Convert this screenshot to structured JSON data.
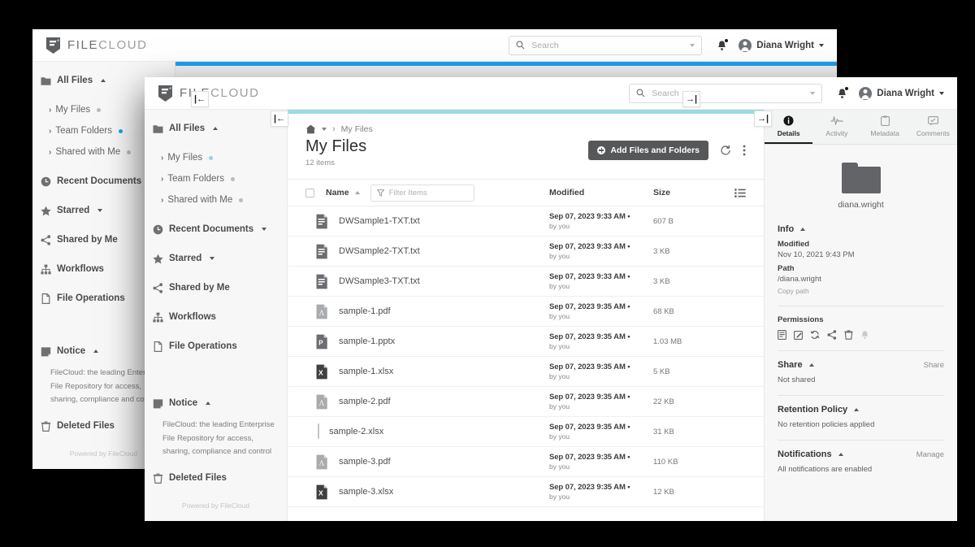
{
  "colors": {
    "accent_back": "#1e9ff2",
    "accent_front": "#9edade",
    "primary_button": "#565759",
    "page_background": "#000000"
  },
  "brand": {
    "name_strong": "FILE",
    "name_light": "CLOUD",
    "logo_icon": "filecloud-shield-icon"
  },
  "header": {
    "search_placeholder": "Search",
    "search_value": "",
    "search_icon": "search-icon",
    "dropdown_icon": "chevron-down-icon",
    "bell_icon": "bell-icon",
    "avatar_icon": "user-avatar-icon",
    "user_name": "Diana Wright",
    "user_caret_icon": "chevron-down-icon"
  },
  "sidebar": {
    "collapse_icon": "collapse-left-icon",
    "items": [
      {
        "label": "All Files",
        "icon": "folder-icon",
        "caret": "up",
        "dot": "none",
        "sub": false
      },
      {
        "label": "My Files",
        "icon": "",
        "caret": "none",
        "dot": "teal",
        "sub": true
      },
      {
        "label": "Team Folders",
        "icon": "",
        "caret": "none",
        "dot": "grey",
        "sub": true
      },
      {
        "label": "Shared with Me",
        "icon": "",
        "caret": "none",
        "dot": "grey",
        "sub": true
      },
      {
        "label": "Recent Documents",
        "icon": "clock-icon",
        "caret": "down",
        "dot": "none",
        "sub": false
      },
      {
        "label": "Starred",
        "icon": "star-icon",
        "caret": "down",
        "dot": "none",
        "sub": false
      },
      {
        "label": "Shared by Me",
        "icon": "share-icon",
        "caret": "none",
        "dot": "none",
        "sub": false
      },
      {
        "label": "Workflows",
        "icon": "workflow-icon",
        "caret": "none",
        "dot": "none",
        "sub": false
      },
      {
        "label": "File Operations",
        "icon": "file-operations-icon",
        "caret": "none",
        "dot": "none",
        "sub": false
      }
    ],
    "items_back": [
      {
        "label": "All Files",
        "icon": "folder-icon",
        "caret": "up",
        "dot": "none",
        "sub": false
      },
      {
        "label": "My Files",
        "icon": "",
        "caret": "none",
        "dot": "grey",
        "sub": true
      },
      {
        "label": "Team Folders",
        "icon": "",
        "caret": "none",
        "dot": "blue",
        "sub": true
      },
      {
        "label": "Shared with Me",
        "icon": "",
        "caret": "none",
        "dot": "grey",
        "sub": true
      },
      {
        "label": "Recent Documents",
        "icon": "clock-icon",
        "caret": "down",
        "dot": "none",
        "sub": false
      },
      {
        "label": "Starred",
        "icon": "star-icon",
        "caret": "down",
        "dot": "none",
        "sub": false
      },
      {
        "label": "Shared by Me",
        "icon": "share-icon",
        "caret": "none",
        "dot": "none",
        "sub": false
      },
      {
        "label": "Workflows",
        "icon": "workflow-icon",
        "caret": "none",
        "dot": "none",
        "sub": false
      },
      {
        "label": "File Operations",
        "icon": "file-operations-icon",
        "caret": "none",
        "dot": "none",
        "sub": false
      }
    ],
    "notice": {
      "title": "Notice",
      "icon": "notice-icon",
      "caret": "up",
      "body": "FileCloud: the leading Enterprise File Repository for access, sharing, compliance and control"
    },
    "deleted_files": {
      "label": "Deleted Files",
      "icon": "trash-icon"
    },
    "footer": "Powered by FileCloud"
  },
  "breadcrumb": {
    "home_icon": "home-icon",
    "home_caret_icon": "chevron-down-icon",
    "separator": "›",
    "current": "My Files"
  },
  "page": {
    "title": "My Files",
    "item_count": "12 items",
    "add_button_label": "Add Files and Folders",
    "add_button_icon": "plus-circle-icon",
    "refresh_icon": "refresh-icon",
    "more_icon": "more-vertical-icon"
  },
  "table": {
    "select_all_checkbox": "unchecked",
    "columns": {
      "name": "Name",
      "modified": "Modified",
      "size": "Size"
    },
    "sort_icon": "sort-asc-icon",
    "filter_icon": "filter-funnel-icon",
    "filter_placeholder": "Filter Items",
    "filter_value": "",
    "view_toggle_icon": "list-view-icon",
    "rows": [
      {
        "name": "DWSample1-TXT.txt",
        "icon": "txt-file-icon",
        "modified": "Sep 07, 2023 9:33 AM •",
        "by": "by you",
        "size": "607 B",
        "selected": false
      },
      {
        "name": "DWSample2-TXT.txt",
        "icon": "txt-file-icon",
        "modified": "Sep 07, 2023 9:33 AM •",
        "by": "by you",
        "size": "3 KB",
        "selected": false
      },
      {
        "name": "DWSample3-TXT.txt",
        "icon": "txt-file-icon",
        "modified": "Sep 07, 2023 9:33 AM •",
        "by": "by you",
        "size": "3 KB",
        "selected": false
      },
      {
        "name": "sample-1.pdf",
        "icon": "pdf-file-icon",
        "modified": "Sep 07, 2023 9:35 AM •",
        "by": "by you",
        "size": "68 KB",
        "selected": false
      },
      {
        "name": "sample-1.pptx",
        "icon": "pptx-file-icon",
        "modified": "Sep 07, 2023 9:35 AM •",
        "by": "by you",
        "size": "1.03 MB",
        "selected": false
      },
      {
        "name": "sample-1.xlsx",
        "icon": "xlsx-file-icon",
        "modified": "Sep 07, 2023 9:35 AM •",
        "by": "by you",
        "size": "5 KB",
        "selected": false
      },
      {
        "name": "sample-2.pdf",
        "icon": "pdf-file-icon",
        "modified": "Sep 07, 2023 9:35 AM •",
        "by": "by you",
        "size": "22 KB",
        "selected": false
      },
      {
        "name": "sample-2.xlsx",
        "icon": "checkbox-icon",
        "modified": "Sep 07, 2023 9:35 AM •",
        "by": "by you",
        "size": "31 KB",
        "selected": true
      },
      {
        "name": "sample-3.pdf",
        "icon": "pdf-file-icon",
        "modified": "Sep 07, 2023 9:35 AM •",
        "by": "by you",
        "size": "110 KB",
        "selected": false
      },
      {
        "name": "sample-3.xlsx",
        "icon": "xlsx-file-icon",
        "modified": "Sep 07, 2023 9:35 AM •",
        "by": "by you",
        "size": "12 KB",
        "selected": false
      }
    ]
  },
  "details": {
    "collapse_icon": "collapse-right-icon",
    "tabs": [
      {
        "label": "Details",
        "icon": "info-icon",
        "active": true
      },
      {
        "label": "Activity",
        "icon": "activity-icon",
        "active": false
      },
      {
        "label": "Metadata",
        "icon": "clipboard-icon",
        "active": false
      },
      {
        "label": "Comments",
        "icon": "comment-icon",
        "active": false
      }
    ],
    "folder_icon": "folder-large-icon",
    "folder_name": "diana.wright",
    "info": {
      "title": "Info",
      "caret": "up",
      "modified_label": "Modified",
      "modified_value": "Nov 10, 2021 9:43 PM",
      "path_label": "Path",
      "path_value": "/diana.wright",
      "copy_path_label": "Copy path"
    },
    "permissions": {
      "title": "Permissions",
      "icons": [
        {
          "name": "read-icon",
          "glyph": "▤",
          "disabled": false
        },
        {
          "name": "write-icon",
          "glyph": "✎",
          "disabled": false
        },
        {
          "name": "sync-icon",
          "glyph": "↻",
          "disabled": false
        },
        {
          "name": "share-icon",
          "glyph": "☀",
          "disabled": false
        },
        {
          "name": "delete-icon",
          "glyph": "Ὕ1",
          "disabled": false
        },
        {
          "name": "alert-icon",
          "glyph": "ὑ4",
          "disabled": true
        }
      ]
    },
    "share": {
      "title": "Share",
      "caret": "up",
      "action_label": "Share",
      "value": "Not shared"
    },
    "retention": {
      "title": "Retention Policy",
      "caret": "up",
      "value": "No retention policies applied"
    },
    "notifications": {
      "title": "Notifications",
      "caret": "up",
      "action_label": "Manage",
      "value": "All notifications are enabled"
    }
  },
  "back_window": {
    "toolbar_icons": [
      {
        "name": "info-icon",
        "active": true
      },
      {
        "name": "clipboard-icon",
        "active": false
      }
    ]
  }
}
